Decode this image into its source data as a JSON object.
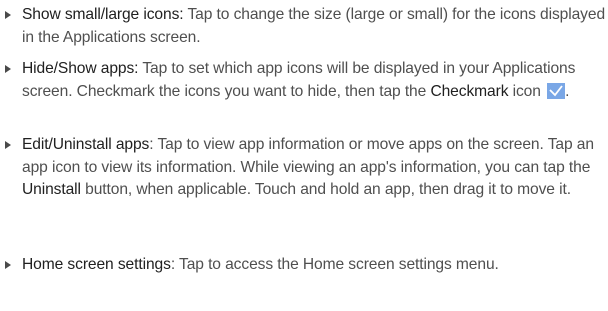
{
  "items": [
    {
      "term": "Show small/large icons:",
      "body": " Tap to change the size (large or small) for the icons displayed in the Applications screen."
    },
    {
      "term": "Hide/Show apps:",
      "body_before": " Tap to set which app icons will be displayed in your Applications screen. Checkmark the icons you want to hide, then tap the ",
      "inline_term": "Checkmark",
      "body_after": " icon",
      "end": "."
    },
    {
      "term": "Edit/Uninstall apps",
      "body_before": ": Tap to view app information or move apps on the screen. Tap an app icon to view its information. While viewing an app's information, you can tap the ",
      "inline_term": "Uninstall",
      "body_after": " button, when applicable. Touch and hold an app, then drag it to move it."
    },
    {
      "term": "Home screen settings",
      "body": ": Tap to access the Home screen settings menu."
    }
  ],
  "icons": {
    "checkmark": "checkmark-icon",
    "checkmark_bg": "#7aa7e6"
  }
}
